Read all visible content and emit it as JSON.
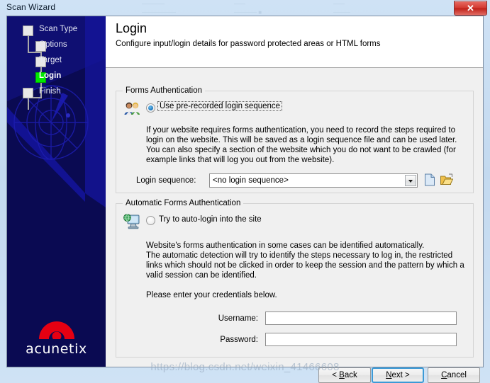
{
  "window": {
    "title": "Scan Wizard",
    "close_label": "✕",
    "ghost_rows": [
      {
        "line1": "————",
        "line2": "——————"
      },
      {
        "line1": "——",
        "line2": "———— ■"
      },
      {
        "line1": "——",
        "line2": "———"
      }
    ]
  },
  "sidebar": {
    "steps": [
      {
        "label": "Scan Type",
        "state": "done"
      },
      {
        "label": "Options",
        "state": "done"
      },
      {
        "label": "Target",
        "state": "done"
      },
      {
        "label": "Login",
        "state": "active"
      },
      {
        "label": "Finish",
        "state": "pending"
      }
    ],
    "brand": "acunetix"
  },
  "header": {
    "title": "Login",
    "subtitle": "Configure input/login details for password protected areas or HTML forms"
  },
  "forms_auth": {
    "group_title": "Forms Authentication",
    "radio_label": "Use pre-recorded login sequence",
    "radio_checked": true,
    "description": "If your website requires forms authentication, you need to record the steps required to login on the website. This will be saved as a login sequence file and can be used later.\nYou can also specify a section of the website which you do not want to be crawled (for example links that will log you out from the website).",
    "sequence_label": "Login sequence:",
    "sequence_value": "<no login sequence>",
    "new_icon": "new-file-icon",
    "open_icon": "open-folder-icon",
    "people_icon": "users-icon"
  },
  "auto_auth": {
    "group_title": "Automatic Forms Authentication",
    "radio_label": "Try to auto-login into the site",
    "radio_checked": false,
    "description": "Website's forms authentication in some cases can be identified automatically.\nThe automatic detection will try to identify the steps necessary to log in, the restricted links which should not be clicked in order to keep the session and the pattern by which a valid session can be identified.",
    "credentials_hint": "Please enter your credentials below.",
    "username_label": "Username:",
    "username_value": "",
    "password_label": "Password:",
    "password_value": "",
    "monitor_icon": "computer-globe-icon"
  },
  "footer": {
    "back_label": "< Back",
    "next_label": "Next >",
    "cancel_label": "Cancel",
    "back_accel": "B",
    "next_accel": "N",
    "cancel_accel": "C"
  },
  "watermark": {
    "text": "https://blog.csdn.net/weixin_41466608"
  },
  "colors": {
    "sidebar_bg": "#0a0a52",
    "accent_active": "#00e800",
    "brand_red": "#e60012",
    "focus_blue": "#3c9ad6",
    "close_red": "#d23a31"
  }
}
